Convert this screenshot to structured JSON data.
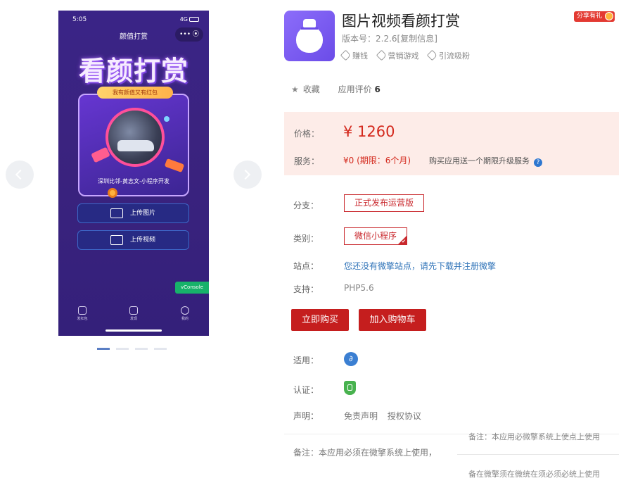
{
  "phone": {
    "time": "5:05",
    "signal": "4G",
    "nav_title": "颜值打赏",
    "capsule": "•••  ⦿",
    "hero_text": "看颜打赏",
    "ribbon_text": "我有颜值又有红包",
    "card_text": "深圳比邻-黄志文-小程序开发",
    "upload_image_label": "上传图片",
    "upload_video_label": "上传视频",
    "vconsole_label": "vConsole",
    "tabs": [
      "发红包",
      "发现",
      "我的"
    ]
  },
  "app": {
    "title": "图片视频看颜打赏",
    "share_gift": "分享有礼",
    "version": "版本号：2.2.6[复制信息]",
    "tags": [
      "赚钱",
      "营销游戏",
      "引流吸粉"
    ],
    "favorite": "收藏",
    "rating_label": "应用评价",
    "rating_count": "6"
  },
  "price": {
    "label": "价格：",
    "value": "¥ 1260",
    "service_label": "服务：",
    "service_value": "¥0 (期限：6个月)",
    "service_note": "购买应用送一个期限升级服务",
    "help_icon": "?"
  },
  "details": {
    "branch_label": "分支：",
    "branch_value": "正式发布运营版",
    "category_label": "类别：",
    "category_value": "微信小程序",
    "site_label": "站点：",
    "site_value": "您还没有微擎站点，请先下载并注册微擎",
    "support_label": "支持：",
    "support_value": "PHP5.6"
  },
  "actions": {
    "buy_label": "立即购买",
    "cart_label": "加入购物车"
  },
  "meta": {
    "apply_label": "适用：",
    "cert_label": "认证：",
    "decl_label": "声明：",
    "disclaimer": "免责声明",
    "license": "授权协议"
  },
  "notes": {
    "main": "备注：本应用必须在微擎系统上使用，",
    "overlay_a": "备注：本应用必微擎系统上使点上使用",
    "overlay_b": "备在微擎须在微统在须必须必统上使用"
  },
  "colors": {
    "accent_red": "#c51e1e",
    "price_red": "#d42a1e",
    "link_blue": "#2f73b8",
    "phone_purple": "#3a2487"
  }
}
